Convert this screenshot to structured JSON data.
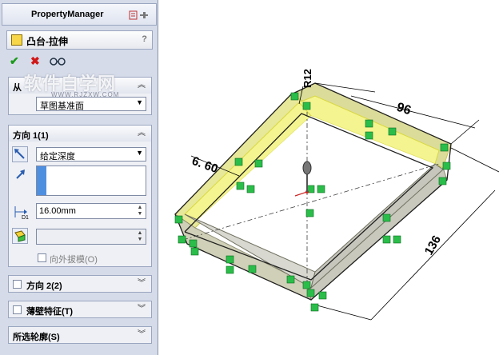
{
  "property_manager": {
    "title": "PropertyManager",
    "feature_title": "凸台-拉伸",
    "help": "?",
    "from": {
      "label": "从",
      "value": "草图基准面"
    },
    "direction1": {
      "label": "方向 1(1)",
      "end_condition": "给定深度",
      "depth": "16.00mm",
      "depth_icon_label": "D1",
      "draft_outward": "向外拔模(O)"
    },
    "direction2": "方向 2(2)",
    "thin_feature": "薄壁特征(T)",
    "selected_contours": "所选轮廓(S)"
  },
  "watermark": {
    "text": "软件自学网",
    "url": "WWW.RJZXW.COM"
  },
  "dimensions": {
    "r12": "R12",
    "d96": "96",
    "d660": "6. 60",
    "d136": "136"
  },
  "colors": {
    "panel": "#d6dbe9",
    "highlight": "#f0f060",
    "body": "#c8c8bc",
    "relation": "#2bbd4a"
  }
}
